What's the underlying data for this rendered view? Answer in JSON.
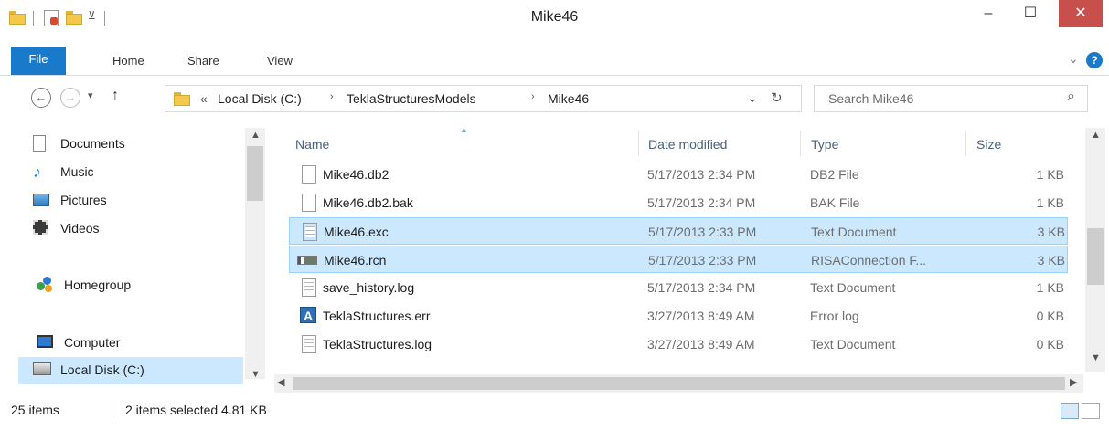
{
  "window": {
    "title": "Mike46",
    "minimize": "–",
    "maximize": "☐",
    "close": "✕"
  },
  "ribbon": {
    "tabs": [
      "File",
      "Home",
      "Share",
      "View"
    ],
    "expand_glyph": "⌄",
    "help_glyph": "?"
  },
  "address": {
    "back": "←",
    "forward": "→",
    "recent": "▾",
    "up": "↑",
    "overflow": "«",
    "crumbs": [
      "Local Disk (C:)",
      "TeklaStructuresModels",
      "Mike46"
    ],
    "crumb_sep": "›",
    "dropdown": "⌄",
    "refresh": "↻"
  },
  "search": {
    "placeholder": "Search Mike46",
    "icon": "⌕"
  },
  "nav": {
    "items": [
      {
        "label": "Documents",
        "icon": "documents-icon"
      },
      {
        "label": "Music",
        "icon": "music-icon"
      },
      {
        "label": "Pictures",
        "icon": "pictures-icon"
      },
      {
        "label": "Videos",
        "icon": "videos-icon"
      },
      {
        "label": "Homegroup",
        "icon": "homegroup-icon"
      },
      {
        "label": "Computer",
        "icon": "computer-icon"
      },
      {
        "label": "Local Disk (C:)",
        "icon": "local-disk-icon"
      }
    ]
  },
  "columns": {
    "name": "Name",
    "date": "Date modified",
    "type": "Type",
    "size": "Size"
  },
  "files": [
    {
      "name": "Mike46.db2",
      "date": "5/17/2013 2:34 PM",
      "type": "DB2 File",
      "size": "1 KB",
      "selected": false,
      "icon": "blank-file-icon"
    },
    {
      "name": "Mike46.db2.bak",
      "date": "5/17/2013 2:34 PM",
      "type": "BAK File",
      "size": "1 KB",
      "selected": false,
      "icon": "blank-file-icon"
    },
    {
      "name": "Mike46.exc",
      "date": "5/17/2013 2:33 PM",
      "type": "Text Document",
      "size": "3 KB",
      "selected": true,
      "icon": "text-file-icon"
    },
    {
      "name": "Mike46.rcn",
      "date": "5/17/2013 2:33 PM",
      "type": "RISAConnection F...",
      "size": "3 KB",
      "selected": true,
      "icon": "risaconnection-file-icon"
    },
    {
      "name": "save_history.log",
      "date": "5/17/2013 2:34 PM",
      "type": "Text Document",
      "size": "1 KB",
      "selected": false,
      "icon": "text-file-icon"
    },
    {
      "name": "TeklaStructures.err",
      "date": "3/27/2013 8:49 AM",
      "type": "Error log",
      "size": "0 KB",
      "selected": false,
      "icon": "tekla-err-icon"
    },
    {
      "name": "TeklaStructures.log",
      "date": "3/27/2013 8:49 AM",
      "type": "Text Document",
      "size": "0 KB",
      "selected": false,
      "icon": "text-file-icon"
    }
  ],
  "status": {
    "count": "25 items",
    "selection": "2 items selected  4.81 KB"
  }
}
